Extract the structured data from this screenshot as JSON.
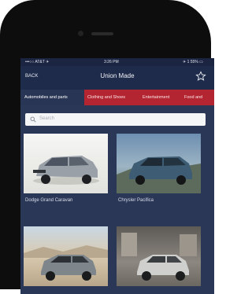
{
  "status_bar": {
    "carrier": "•••○○ AT&T ✈",
    "time": "3:26 PM",
    "battery": "✈ 1 55% ▭"
  },
  "nav": {
    "back_label": "BACK",
    "title": "Union Made",
    "star_icon": "star-icon"
  },
  "tabs": [
    {
      "label": "Automobiles and parts",
      "active": true
    },
    {
      "label": "Clothing and Shoes",
      "active": false
    },
    {
      "label": "Entertainment",
      "active": false
    },
    {
      "label": "Food and",
      "active": false
    }
  ],
  "search": {
    "placeholder": "Search"
  },
  "products": [
    {
      "name": "Dodge Grand Caravan"
    },
    {
      "name": "Chrysler Pacifica"
    },
    {
      "name": ""
    },
    {
      "name": ""
    }
  ],
  "colors": {
    "tab_bar": "#b42532",
    "nav_bar": "#1f2b4a",
    "content": "#2a3757"
  }
}
